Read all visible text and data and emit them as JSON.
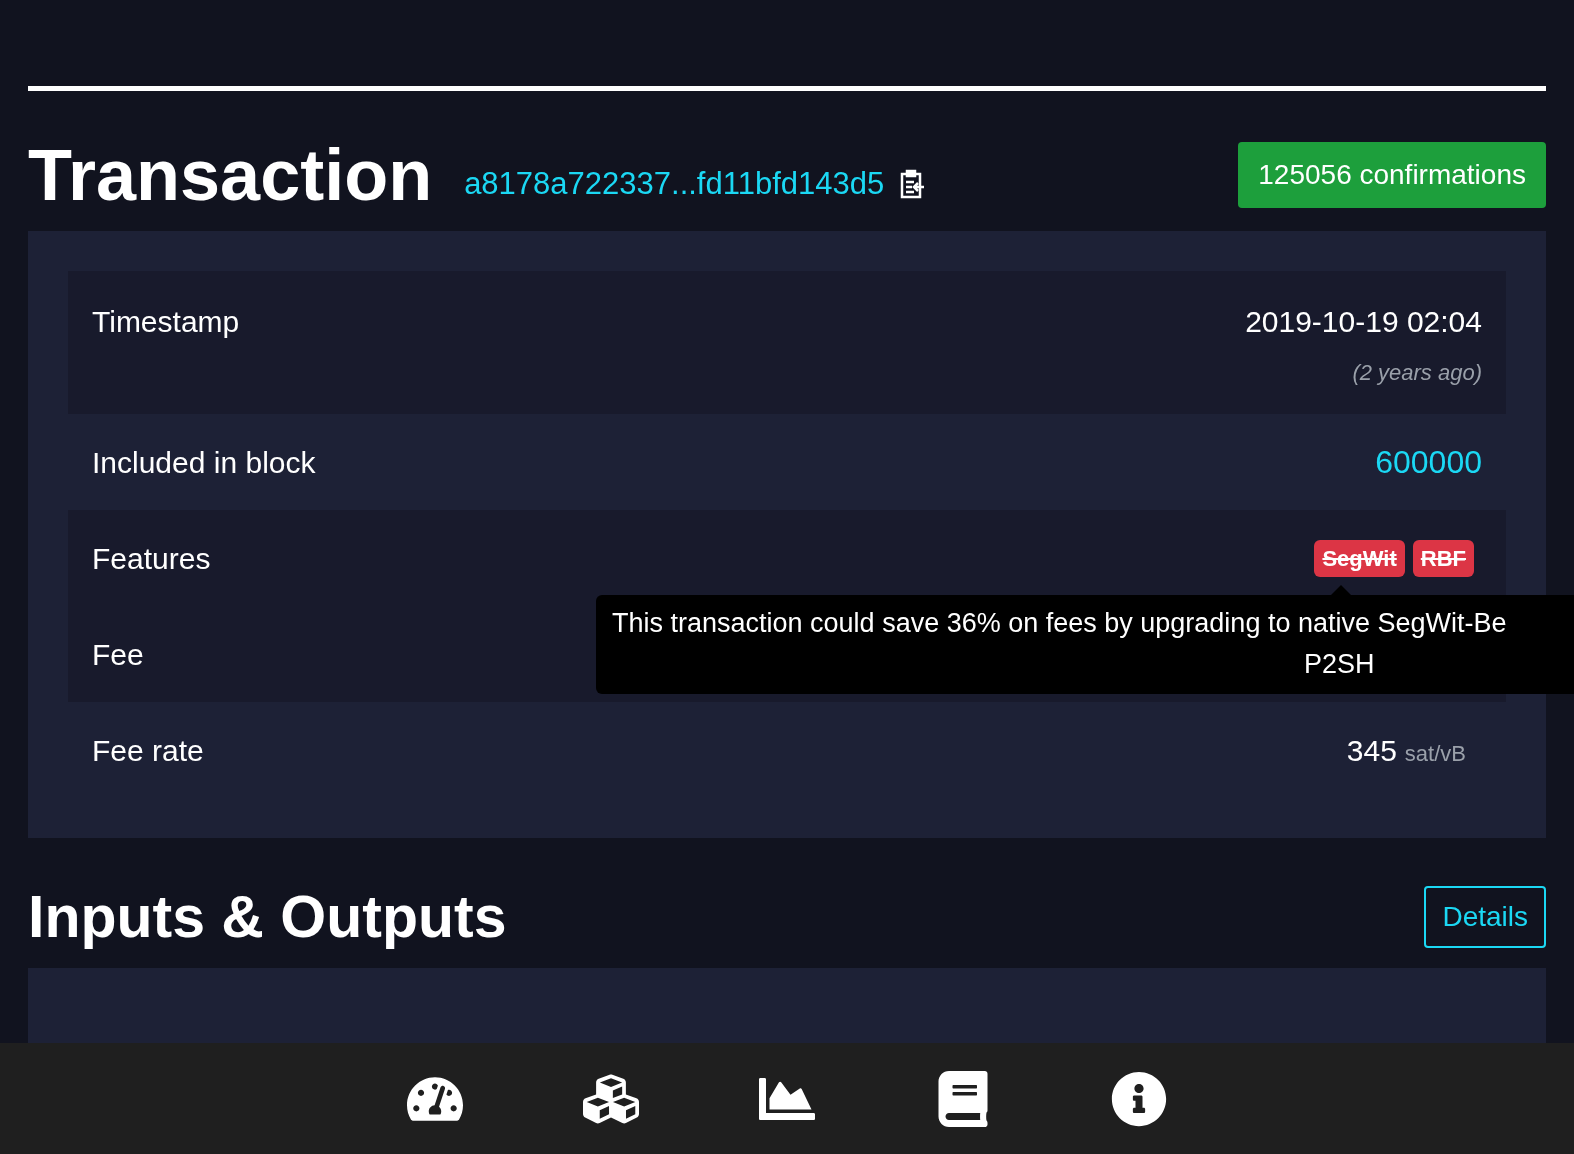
{
  "header": {
    "title": "Transaction",
    "txid": "a8178a722337...fd11bfd143d5",
    "confirmations": "125056 confirmations"
  },
  "details": [
    {
      "kind": "timestamp",
      "label": "Timestamp",
      "value": "2019-10-19 02:04",
      "note": "(2 years ago)"
    },
    {
      "kind": "link",
      "label": "Included in block",
      "value": "600000"
    },
    {
      "kind": "features",
      "label": "Features",
      "badges": [
        {
          "label": "SegWit",
          "struck": true
        },
        {
          "label": "RBF",
          "struck": true
        }
      ]
    },
    {
      "kind": "plain",
      "label": "Fee"
    },
    {
      "kind": "rate",
      "label": "Fee rate",
      "value": "345",
      "unit": "sat/vB"
    }
  ],
  "tooltip": {
    "line1": "This transaction could save 36% on fees by upgrading to native SegWit-Be",
    "line2": "P2SH"
  },
  "io": {
    "title": "Inputs & Outputs",
    "button": "Details"
  },
  "nav": [
    {
      "kind": "gauge"
    },
    {
      "kind": "blocks"
    },
    {
      "kind": "chart"
    },
    {
      "kind": "book"
    },
    {
      "kind": "info"
    }
  ]
}
